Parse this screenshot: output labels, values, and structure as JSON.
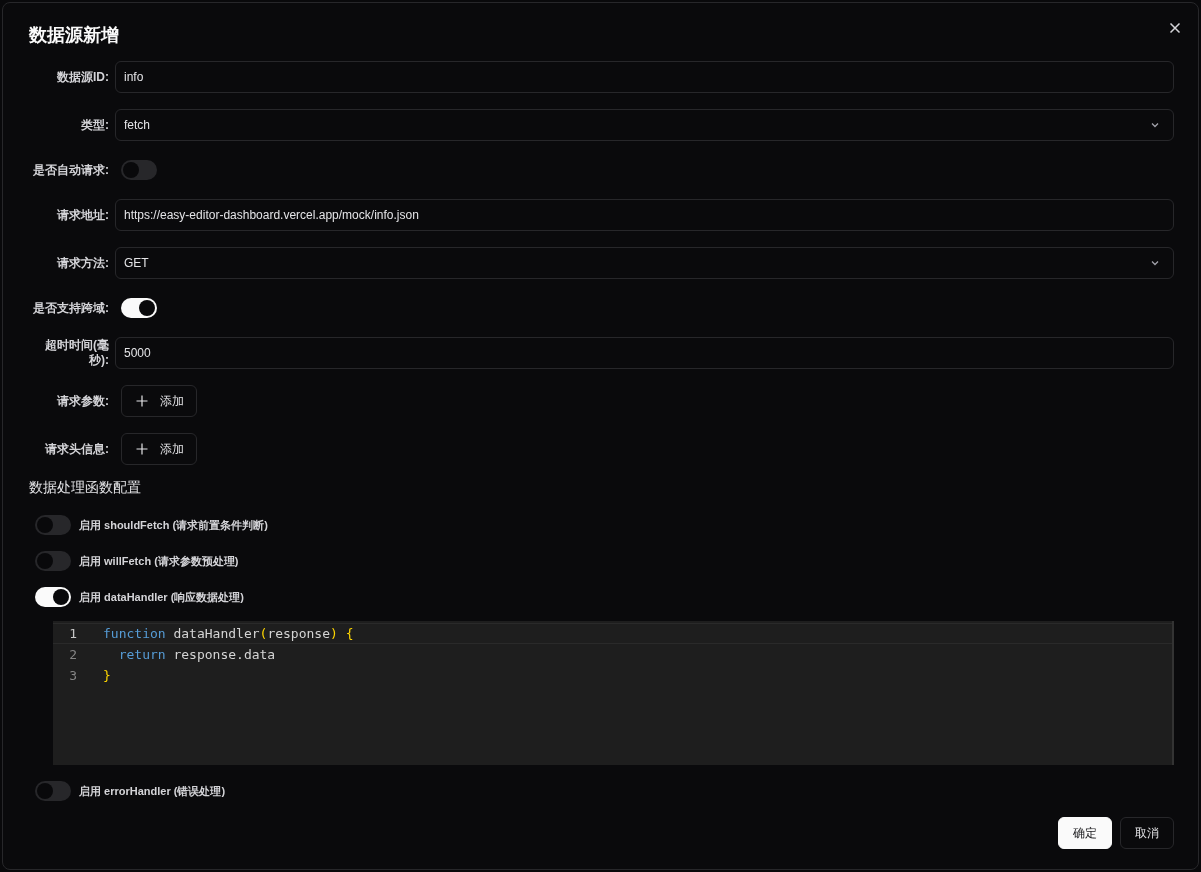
{
  "dialog": {
    "title": "数据源新增"
  },
  "fields": [
    {
      "kind": "input",
      "label": "数据源ID:",
      "value": "info"
    },
    {
      "kind": "select",
      "label": "类型:",
      "value": "fetch"
    },
    {
      "kind": "switch",
      "label": "是否自动请求:",
      "on": false
    },
    {
      "kind": "input",
      "label": "请求地址:",
      "value": "https://easy-editor-dashboard.vercel.app/mock/info.json"
    },
    {
      "kind": "select",
      "label": "请求方法:",
      "value": "GET"
    },
    {
      "kind": "switch",
      "label": "是否支持跨域:",
      "on": true
    },
    {
      "kind": "input",
      "label": "超时时间(毫秒):",
      "value": "5000"
    },
    {
      "kind": "add",
      "label": "请求参数:",
      "button": "添加"
    },
    {
      "kind": "add",
      "label": "请求头信息:",
      "button": "添加"
    }
  ],
  "section_title": "数据处理函数配置",
  "handlers": [
    {
      "label": "启用 shouldFetch (请求前置条件判断)",
      "on": false
    },
    {
      "label": "启用 willFetch (请求参数预处理)",
      "on": false
    },
    {
      "label": "启用 dataHandler (响应数据处理)",
      "on": true,
      "code": [
        {
          "number": "1",
          "active": true,
          "tokens": [
            {
              "kind": "keyword",
              "text": "function"
            },
            {
              "kind": "plain",
              "text": " dataHandler"
            },
            {
              "kind": "bracket",
              "text": "("
            },
            {
              "kind": "plain",
              "text": "response"
            },
            {
              "kind": "bracket",
              "text": ")"
            },
            {
              "kind": "brace",
              "text": " {"
            }
          ]
        },
        {
          "number": "2",
          "active": false,
          "tokens": [
            {
              "kind": "keyword",
              "text": "  return"
            },
            {
              "kind": "plain",
              "text": " response.data"
            }
          ]
        },
        {
          "number": "3",
          "active": false,
          "tokens": [
            {
              "kind": "brace",
              "text": "}"
            }
          ]
        }
      ]
    },
    {
      "label": "启用 errorHandler (错误处理)",
      "on": false
    }
  ],
  "buttons": [
    {
      "label": "确定",
      "primary": true
    },
    {
      "label": "取消",
      "primary": false
    }
  ]
}
